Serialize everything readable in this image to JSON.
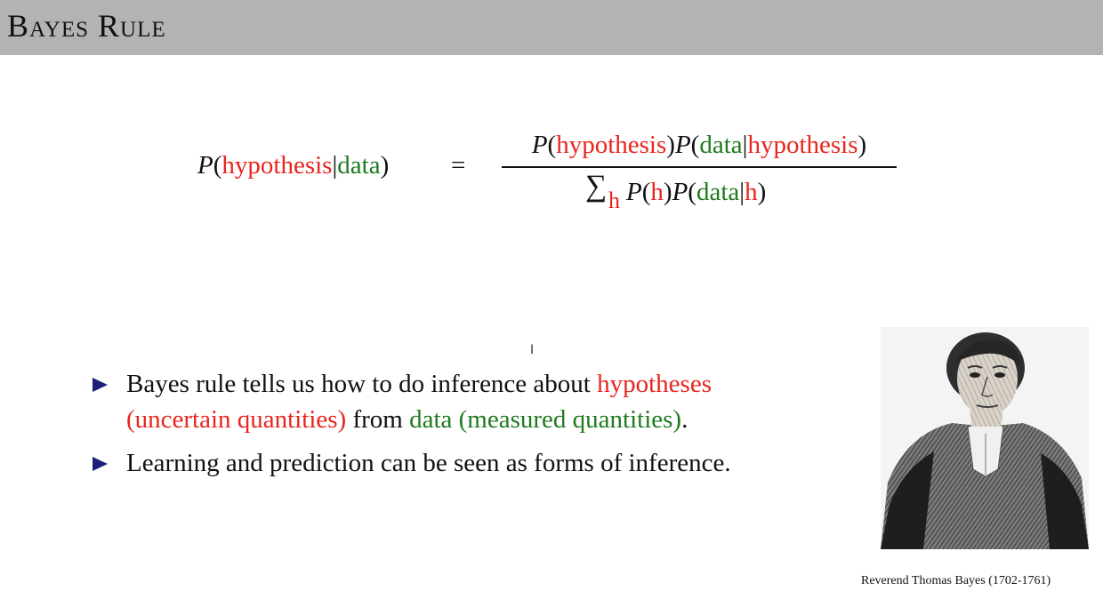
{
  "slide": {
    "title": "Bayes Rule"
  },
  "formula": {
    "p": "P",
    "open": "(",
    "close": ")",
    "bar": "|",
    "equals": "=",
    "hypothesis": "hypothesis",
    "data": "data",
    "sum_symbol": "∑",
    "h": "h"
  },
  "bullets": {
    "items": [
      {
        "text1": "Bayes rule tells us how to do inference about ",
        "text2": "hypotheses (uncertain quantities)",
        "text3": " from ",
        "text4": "data (measured quantities)",
        "text5": "."
      },
      {
        "text1": "Learning and prediction can be seen as forms of inference."
      }
    ]
  },
  "cursor": {
    "glyph": "I"
  },
  "portrait": {
    "caption": "Reverend Thomas Bayes (1702-1761)"
  },
  "colors": {
    "title_bar": "#b3b3b3",
    "hypothesis_red": "#e8251e",
    "data_green": "#1f7a1f",
    "bullet_navy": "#1f1f7a"
  }
}
